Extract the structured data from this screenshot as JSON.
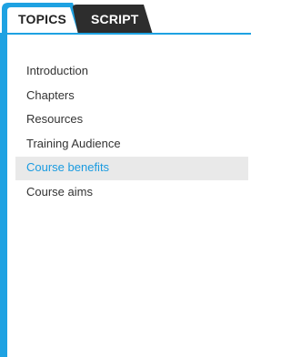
{
  "tabs": [
    {
      "label": "TOPICS",
      "active": true
    },
    {
      "label": "SCRIPT",
      "active": false
    }
  ],
  "menu": {
    "items": [
      {
        "label": "Introduction"
      },
      {
        "label": "Chapters"
      },
      {
        "label": "Resources"
      },
      {
        "label": "Training Audience"
      },
      {
        "label": "Course benefits",
        "selected": true
      },
      {
        "label": "Course aims"
      }
    ]
  },
  "colors": {
    "accent": "#1ea2e2",
    "selected_text": "#1a9be0",
    "selected_bg": "#e9e9e9",
    "inactive_tab": "#2d2d2d"
  }
}
